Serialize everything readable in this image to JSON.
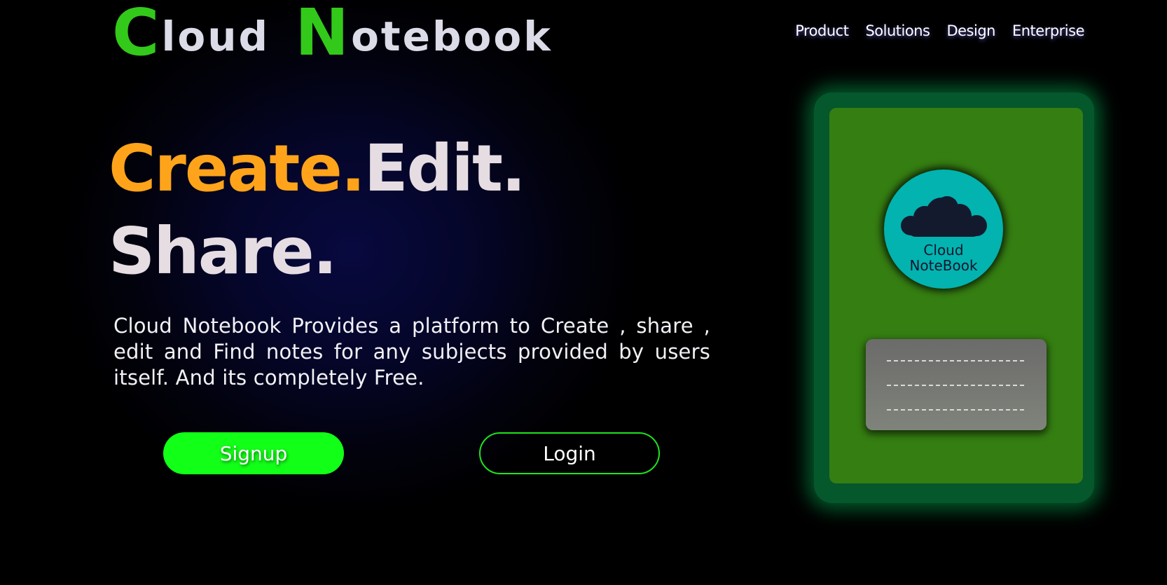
{
  "brand": {
    "first_letter": "C",
    "first_rest": "loud",
    "second_letter": "N",
    "second_rest": "otebook",
    "accent_color": "#33c91a"
  },
  "nav": {
    "items": [
      "Product",
      "Solutions",
      "Design",
      "Enterprise"
    ]
  },
  "hero": {
    "headline_part1": "Create.",
    "headline_part2": "Edit.",
    "headline_part3": "Share.",
    "description": "Cloud Notebook Provides a platform to Create , share , edit and Find notes for any subjects provided by users itself. And its completely Free.",
    "signup_label": "Signup",
    "login_label": "Login"
  },
  "illustration": {
    "badge_line1": "Cloud",
    "badge_line2": "NoteBook",
    "card_color": "#357e12",
    "badge_color": "#02b3b0",
    "icon": "cloud-icon"
  },
  "colors": {
    "headline_accent": "#ffa41a",
    "signup_button": "#12ff17",
    "login_border": "#1ee31e"
  }
}
